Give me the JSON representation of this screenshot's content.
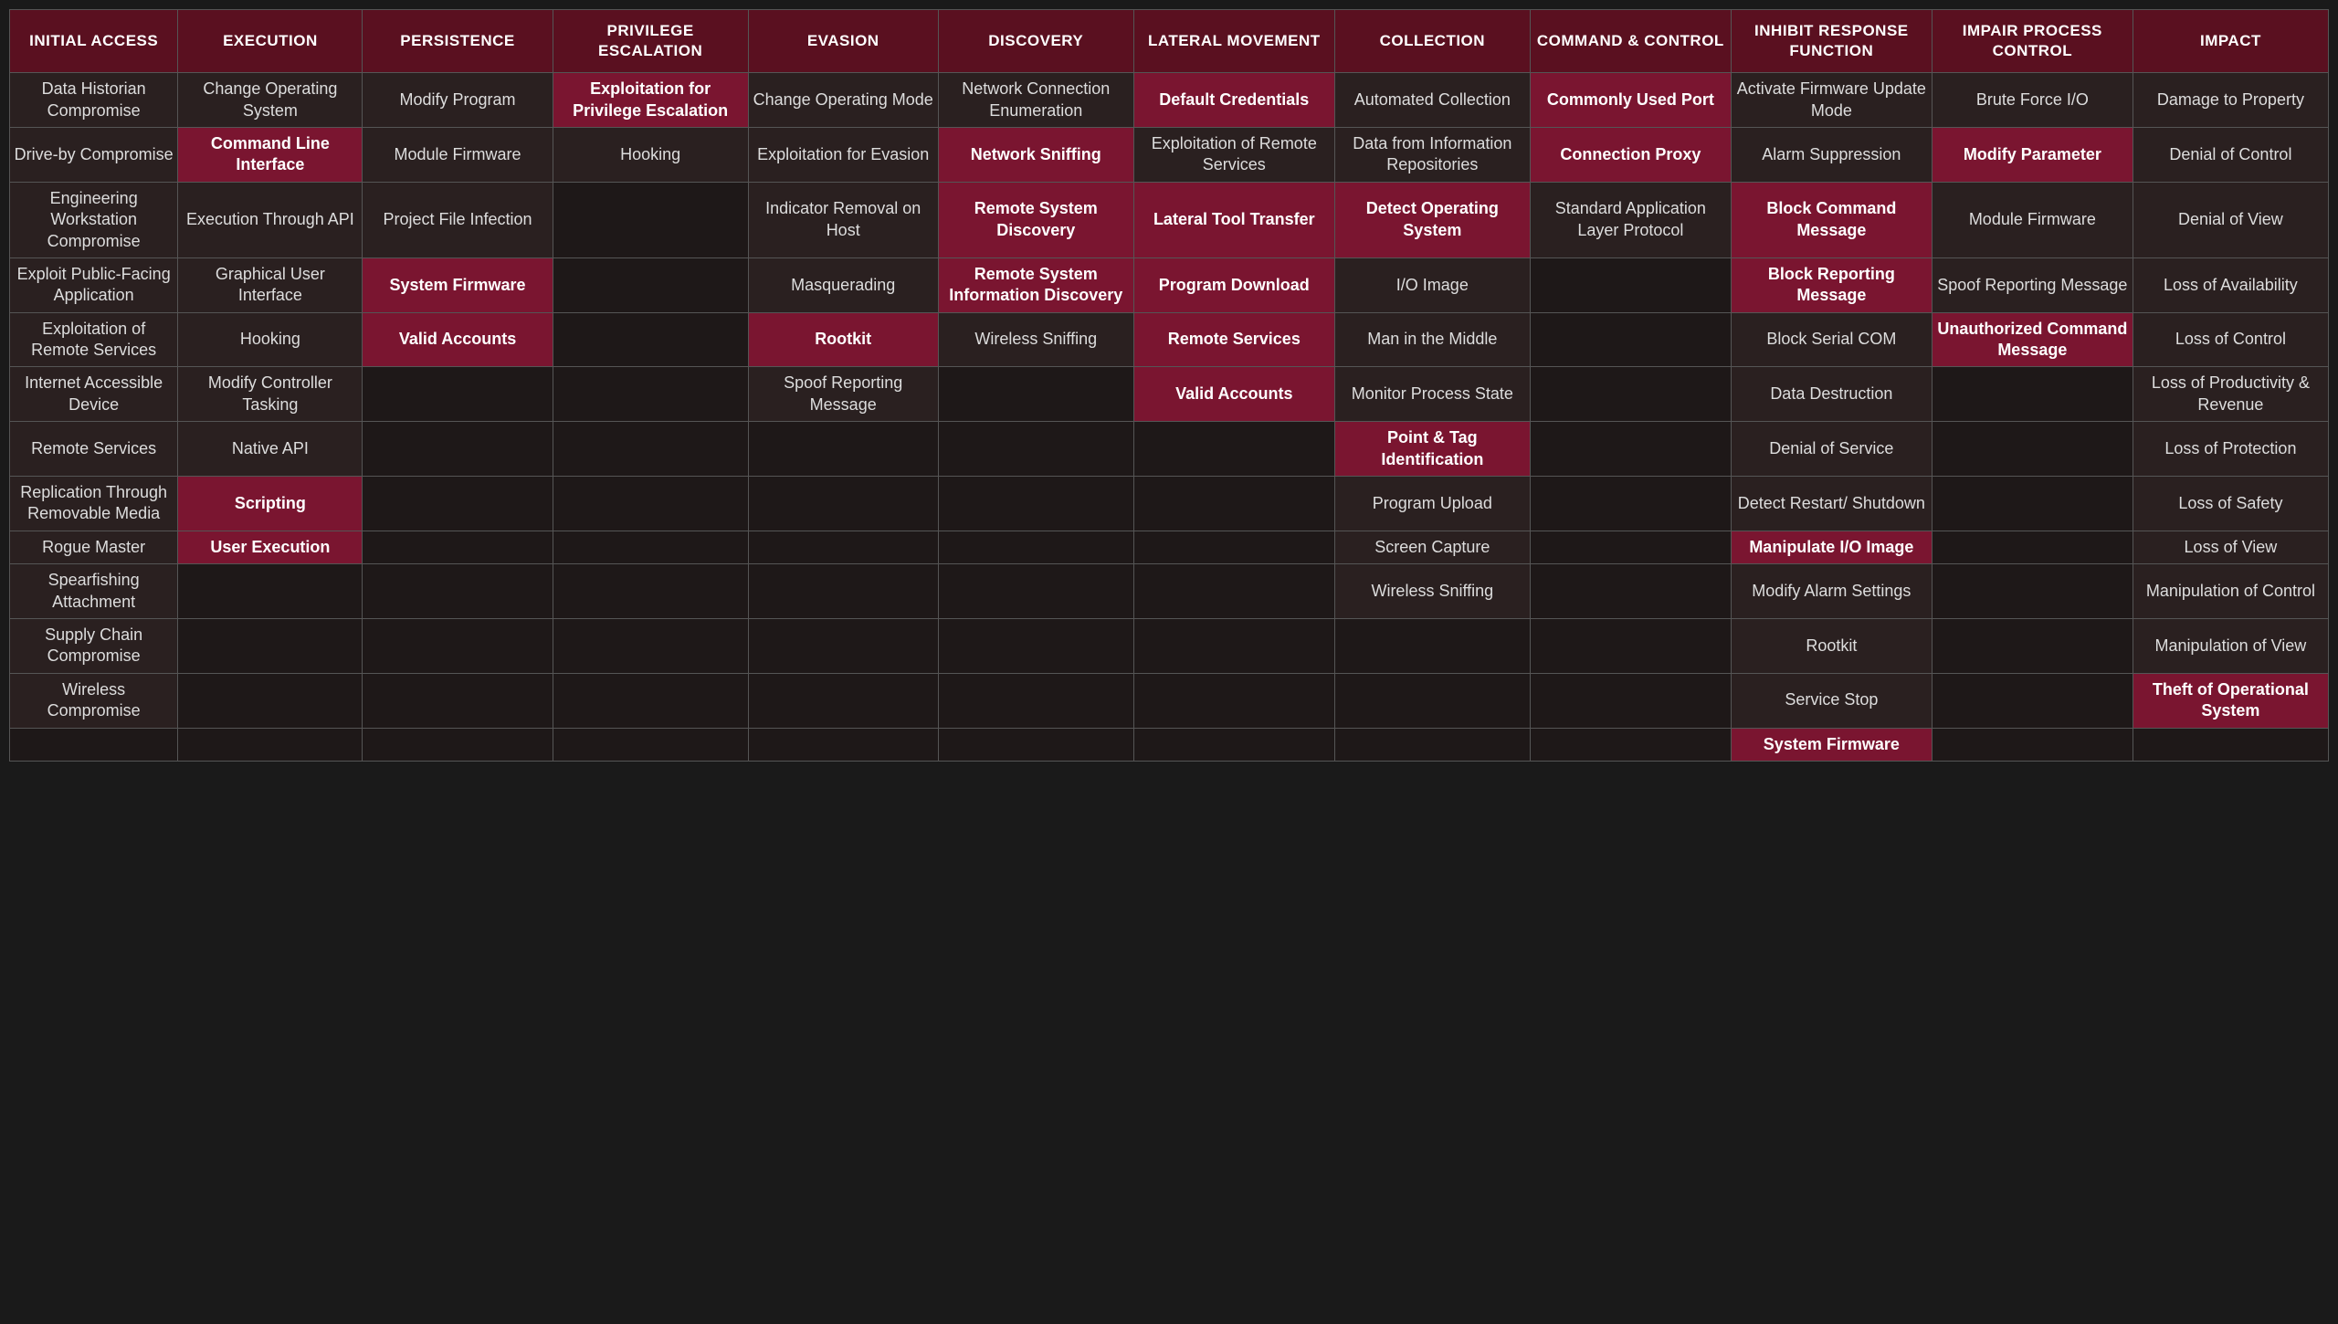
{
  "headers": [
    "Initial Access",
    "Execution",
    "Persistence",
    "Privilege Escalation",
    "Evasion",
    "Discovery",
    "Lateral Movement",
    "Collection",
    "Command & Control",
    "Inhibit Response Function",
    "Impair Process Control",
    "Impact"
  ],
  "rows": [
    {
      "cells": [
        {
          "text": "Data Historian Compromise",
          "type": "normal"
        },
        {
          "text": "Change Operating System",
          "type": "normal"
        },
        {
          "text": "Modify Program",
          "type": "normal"
        },
        {
          "text": "Exploitation for Privilege Escalation",
          "type": "highlighted"
        },
        {
          "text": "Change Operating Mode",
          "type": "normal"
        },
        {
          "text": "Network Connection Enumeration",
          "type": "normal"
        },
        {
          "text": "Default Credentials",
          "type": "highlighted"
        },
        {
          "text": "Automated Collection",
          "type": "normal"
        },
        {
          "text": "Commonly Used Port",
          "type": "highlighted"
        },
        {
          "text": "Activate Firmware Update Mode",
          "type": "normal"
        },
        {
          "text": "Brute Force I/O",
          "type": "normal"
        },
        {
          "text": "Damage to Property",
          "type": "normal"
        }
      ]
    },
    {
      "cells": [
        {
          "text": "Drive-by Compromise",
          "type": "normal"
        },
        {
          "text": "Command Line Interface",
          "type": "highlighted"
        },
        {
          "text": "Module Firmware",
          "type": "normal"
        },
        {
          "text": "Hooking",
          "type": "normal"
        },
        {
          "text": "Exploitation for Evasion",
          "type": "normal"
        },
        {
          "text": "Network Sniffing",
          "type": "highlighted"
        },
        {
          "text": "Exploitation of Remote Services",
          "type": "normal"
        },
        {
          "text": "Data from Information Repositories",
          "type": "normal"
        },
        {
          "text": "Connection Proxy",
          "type": "highlighted"
        },
        {
          "text": "Alarm Suppression",
          "type": "normal"
        },
        {
          "text": "Modify Parameter",
          "type": "highlighted"
        },
        {
          "text": "Denial of Control",
          "type": "normal"
        }
      ]
    },
    {
      "cells": [
        {
          "text": "Engineering Workstation Compromise",
          "type": "normal"
        },
        {
          "text": "Execution Through API",
          "type": "normal"
        },
        {
          "text": "Project File Infection",
          "type": "normal"
        },
        {
          "text": "",
          "type": "empty"
        },
        {
          "text": "Indicator Removal on Host",
          "type": "normal"
        },
        {
          "text": "Remote System Discovery",
          "type": "highlighted"
        },
        {
          "text": "Lateral Tool Transfer",
          "type": "highlighted"
        },
        {
          "text": "Detect Operating System",
          "type": "highlighted"
        },
        {
          "text": "Standard Application Layer Protocol",
          "type": "normal"
        },
        {
          "text": "Block Command Message",
          "type": "highlighted"
        },
        {
          "text": "Module Firmware",
          "type": "normal"
        },
        {
          "text": "Denial of View",
          "type": "normal"
        }
      ]
    },
    {
      "cells": [
        {
          "text": "Exploit Public-Facing Application",
          "type": "normal"
        },
        {
          "text": "Graphical User Interface",
          "type": "normal"
        },
        {
          "text": "System Firmware",
          "type": "highlighted"
        },
        {
          "text": "",
          "type": "empty"
        },
        {
          "text": "Masquerading",
          "type": "normal"
        },
        {
          "text": "Remote System Information Discovery",
          "type": "highlighted"
        },
        {
          "text": "Program Download",
          "type": "highlighted"
        },
        {
          "text": "I/O Image",
          "type": "normal"
        },
        {
          "text": "",
          "type": "empty"
        },
        {
          "text": "Block Reporting Message",
          "type": "highlighted"
        },
        {
          "text": "Spoof Reporting Message",
          "type": "normal"
        },
        {
          "text": "Loss of Availability",
          "type": "normal"
        }
      ]
    },
    {
      "cells": [
        {
          "text": "Exploitation of Remote Services",
          "type": "normal"
        },
        {
          "text": "Hooking",
          "type": "normal"
        },
        {
          "text": "Valid Accounts",
          "type": "highlighted"
        },
        {
          "text": "",
          "type": "empty"
        },
        {
          "text": "Rootkit",
          "type": "highlighted"
        },
        {
          "text": "Wireless Sniffing",
          "type": "normal"
        },
        {
          "text": "Remote Services",
          "type": "highlighted"
        },
        {
          "text": "Man in the Middle",
          "type": "normal"
        },
        {
          "text": "",
          "type": "empty"
        },
        {
          "text": "Block Serial COM",
          "type": "normal"
        },
        {
          "text": "Unauthorized Command Message",
          "type": "highlighted"
        },
        {
          "text": "Loss of Control",
          "type": "normal"
        }
      ]
    },
    {
      "cells": [
        {
          "text": "Internet Accessible Device",
          "type": "normal"
        },
        {
          "text": "Modify Controller Tasking",
          "type": "normal"
        },
        {
          "text": "",
          "type": "empty"
        },
        {
          "text": "",
          "type": "empty"
        },
        {
          "text": "Spoof Reporting Message",
          "type": "normal"
        },
        {
          "text": "",
          "type": "empty"
        },
        {
          "text": "Valid Accounts",
          "type": "highlighted"
        },
        {
          "text": "Monitor Process State",
          "type": "normal"
        },
        {
          "text": "",
          "type": "empty"
        },
        {
          "text": "Data Destruction",
          "type": "normal"
        },
        {
          "text": "",
          "type": "empty"
        },
        {
          "text": "Loss of Productivity & Revenue",
          "type": "normal"
        }
      ]
    },
    {
      "cells": [
        {
          "text": "Remote Services",
          "type": "normal"
        },
        {
          "text": "Native API",
          "type": "normal"
        },
        {
          "text": "",
          "type": "empty"
        },
        {
          "text": "",
          "type": "empty"
        },
        {
          "text": "",
          "type": "empty"
        },
        {
          "text": "",
          "type": "empty"
        },
        {
          "text": "",
          "type": "empty"
        },
        {
          "text": "Point & Tag Identification",
          "type": "highlighted"
        },
        {
          "text": "",
          "type": "empty"
        },
        {
          "text": "Denial of Service",
          "type": "normal"
        },
        {
          "text": "",
          "type": "empty"
        },
        {
          "text": "Loss of Protection",
          "type": "normal"
        }
      ]
    },
    {
      "cells": [
        {
          "text": "Replication Through Removable Media",
          "type": "normal"
        },
        {
          "text": "Scripting",
          "type": "highlighted"
        },
        {
          "text": "",
          "type": "empty"
        },
        {
          "text": "",
          "type": "empty"
        },
        {
          "text": "",
          "type": "empty"
        },
        {
          "text": "",
          "type": "empty"
        },
        {
          "text": "",
          "type": "empty"
        },
        {
          "text": "Program Upload",
          "type": "normal"
        },
        {
          "text": "",
          "type": "empty"
        },
        {
          "text": "Detect Restart/ Shutdown",
          "type": "normal"
        },
        {
          "text": "",
          "type": "empty"
        },
        {
          "text": "Loss of Safety",
          "type": "normal"
        }
      ]
    },
    {
      "cells": [
        {
          "text": "Rogue Master",
          "type": "normal"
        },
        {
          "text": "User Execution",
          "type": "highlighted"
        },
        {
          "text": "",
          "type": "empty"
        },
        {
          "text": "",
          "type": "empty"
        },
        {
          "text": "",
          "type": "empty"
        },
        {
          "text": "",
          "type": "empty"
        },
        {
          "text": "",
          "type": "empty"
        },
        {
          "text": "Screen Capture",
          "type": "normal"
        },
        {
          "text": "",
          "type": "empty"
        },
        {
          "text": "Manipulate I/O Image",
          "type": "highlighted"
        },
        {
          "text": "",
          "type": "empty"
        },
        {
          "text": "Loss of View",
          "type": "normal"
        }
      ]
    },
    {
      "cells": [
        {
          "text": "Spearfishing Attachment",
          "type": "normal"
        },
        {
          "text": "",
          "type": "empty"
        },
        {
          "text": "",
          "type": "empty"
        },
        {
          "text": "",
          "type": "empty"
        },
        {
          "text": "",
          "type": "empty"
        },
        {
          "text": "",
          "type": "empty"
        },
        {
          "text": "",
          "type": "empty"
        },
        {
          "text": "Wireless Sniffing",
          "type": "normal"
        },
        {
          "text": "",
          "type": "empty"
        },
        {
          "text": "Modify Alarm Settings",
          "type": "normal"
        },
        {
          "text": "",
          "type": "empty"
        },
        {
          "text": "Manipulation of Control",
          "type": "normal"
        }
      ]
    },
    {
      "cells": [
        {
          "text": "Supply Chain Compromise",
          "type": "normal"
        },
        {
          "text": "",
          "type": "empty"
        },
        {
          "text": "",
          "type": "empty"
        },
        {
          "text": "",
          "type": "empty"
        },
        {
          "text": "",
          "type": "empty"
        },
        {
          "text": "",
          "type": "empty"
        },
        {
          "text": "",
          "type": "empty"
        },
        {
          "text": "",
          "type": "empty"
        },
        {
          "text": "",
          "type": "empty"
        },
        {
          "text": "Rootkit",
          "type": "normal"
        },
        {
          "text": "",
          "type": "empty"
        },
        {
          "text": "Manipulation of View",
          "type": "normal"
        }
      ]
    },
    {
      "cells": [
        {
          "text": "Wireless Compromise",
          "type": "normal"
        },
        {
          "text": "",
          "type": "empty"
        },
        {
          "text": "",
          "type": "empty"
        },
        {
          "text": "",
          "type": "empty"
        },
        {
          "text": "",
          "type": "empty"
        },
        {
          "text": "",
          "type": "empty"
        },
        {
          "text": "",
          "type": "empty"
        },
        {
          "text": "",
          "type": "empty"
        },
        {
          "text": "",
          "type": "empty"
        },
        {
          "text": "Service Stop",
          "type": "normal"
        },
        {
          "text": "",
          "type": "empty"
        },
        {
          "text": "Theft of Operational System",
          "type": "highlighted"
        }
      ]
    },
    {
      "cells": [
        {
          "text": "",
          "type": "empty"
        },
        {
          "text": "",
          "type": "empty"
        },
        {
          "text": "",
          "type": "empty"
        },
        {
          "text": "",
          "type": "empty"
        },
        {
          "text": "",
          "type": "empty"
        },
        {
          "text": "",
          "type": "empty"
        },
        {
          "text": "",
          "type": "empty"
        },
        {
          "text": "",
          "type": "empty"
        },
        {
          "text": "",
          "type": "empty"
        },
        {
          "text": "System Firmware",
          "type": "highlighted"
        },
        {
          "text": "",
          "type": "empty"
        },
        {
          "text": "",
          "type": "empty"
        }
      ]
    }
  ]
}
